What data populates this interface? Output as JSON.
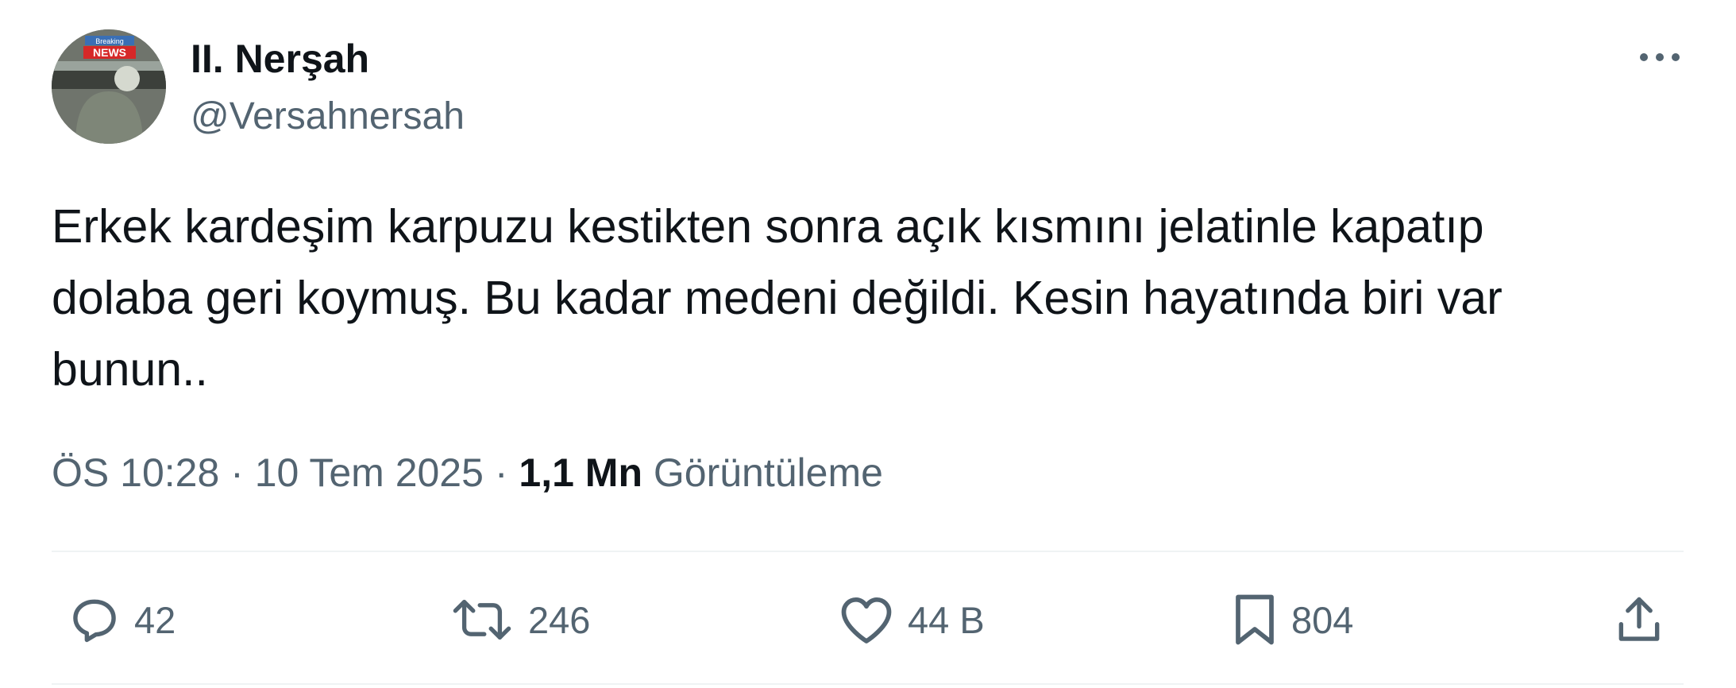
{
  "author": {
    "display_name": "II. Nerşah",
    "handle": "@Versahnersah",
    "avatar_badge_top": "Breaking",
    "avatar_badge_bottom": "NEWS"
  },
  "tweet": {
    "text": "Erkek kardeşim karpuzu kestikten sonra açık kısmını jelatinle kapatıp\ndolaba geri koymuş. Bu kadar medeni değildi. Kesin hayatında biri var\nbunun.."
  },
  "meta": {
    "time": "ÖS 10:28",
    "separator1": "·",
    "date": "10 Tem 2025",
    "separator2": "·",
    "views_count": "1,1 Mn",
    "views_label": "Görüntüleme"
  },
  "actions": {
    "replies": "42",
    "retweets": "246",
    "likes": "44 B",
    "bookmarks": "804"
  },
  "icons": {
    "more": "more-icon",
    "reply": "reply-icon",
    "retweet": "retweet-icon",
    "like": "heart-icon",
    "bookmark": "bookmark-icon",
    "share": "share-icon"
  },
  "colors": {
    "text_primary": "#0f1419",
    "text_secondary": "#536471",
    "divider": "#eff3f4",
    "badge_red": "#d62828"
  }
}
